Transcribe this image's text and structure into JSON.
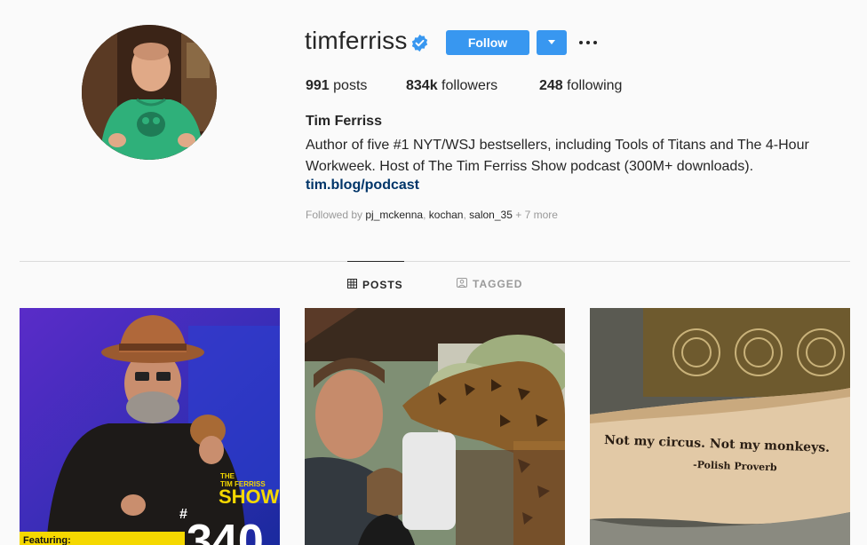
{
  "profile": {
    "username": "timferriss",
    "follow_label": "Follow",
    "stats": {
      "posts_count": "991",
      "posts_label": "posts",
      "followers_count": "834k",
      "followers_label": "followers",
      "following_count": "248",
      "following_label": "following"
    },
    "full_name": "Tim Ferriss",
    "bio_lines": [
      "Author of five #1 NYT/WSJ bestsellers, including Tools of Titans and The 4-Hour",
      "Workweek. Host of The Tim Ferriss Show podcast (300M+ downloads)."
    ],
    "link": "tim.blog/podcast",
    "followed_by": {
      "prefix": "Followed by",
      "users": [
        "pj_mckenna",
        "kochan",
        "salon_35"
      ],
      "sep": ",",
      "more": "+ 7 more"
    }
  },
  "tabs": [
    {
      "label": "POSTS",
      "icon": "grid-icon",
      "active": true
    },
    {
      "label": "TAGGED",
      "icon": "tagged-icon",
      "active": false
    }
  ],
  "posts": [
    {
      "text": {
        "show_top": "THE",
        "show_mid": "TIM FERRISS",
        "show_main": "SHOW",
        "hash": "#",
        "number": "340",
        "featuring": "Featuring:"
      }
    },
    {},
    {
      "text": {
        "quote": "Not my circus. Not my monkeys.",
        "attribution": "-Polish Proverb"
      }
    }
  ],
  "colors": {
    "accent": "#3897f0",
    "link": "#003569",
    "text": "#262626",
    "muted": "#999999",
    "background": "#fafafa",
    "verified": "#3897f0"
  }
}
